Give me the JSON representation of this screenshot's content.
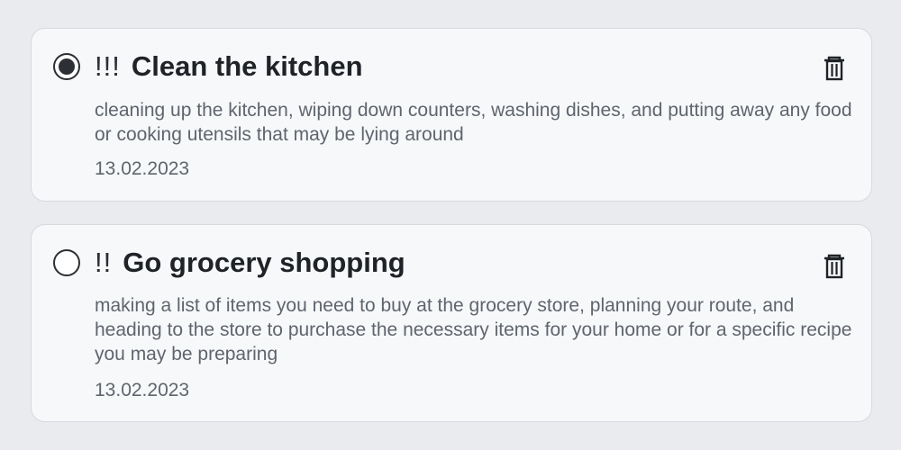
{
  "todos": [
    {
      "completed": true,
      "priority": "!!!",
      "title": "Clean the kitchen",
      "description": "cleaning up the kitchen, wiping down counters, washing dishes, and putting away any food or cooking utensils that may be lying around",
      "date": "13.02.2023",
      "delete_icon": "trash-icon"
    },
    {
      "completed": false,
      "priority": "!!",
      "title": "Go grocery shopping",
      "description": "making a list of items you need to buy at the grocery store, planning your route, and heading to the store to purchase the necessary items for your home or for a specific recipe you may be preparing",
      "date": "13.02.2023",
      "delete_icon": "trash-icon"
    }
  ],
  "colors": {
    "background": "#e9ebef",
    "card": "#f7f8fa",
    "text_primary": "#1f2226",
    "text_secondary": "#5f656d"
  }
}
